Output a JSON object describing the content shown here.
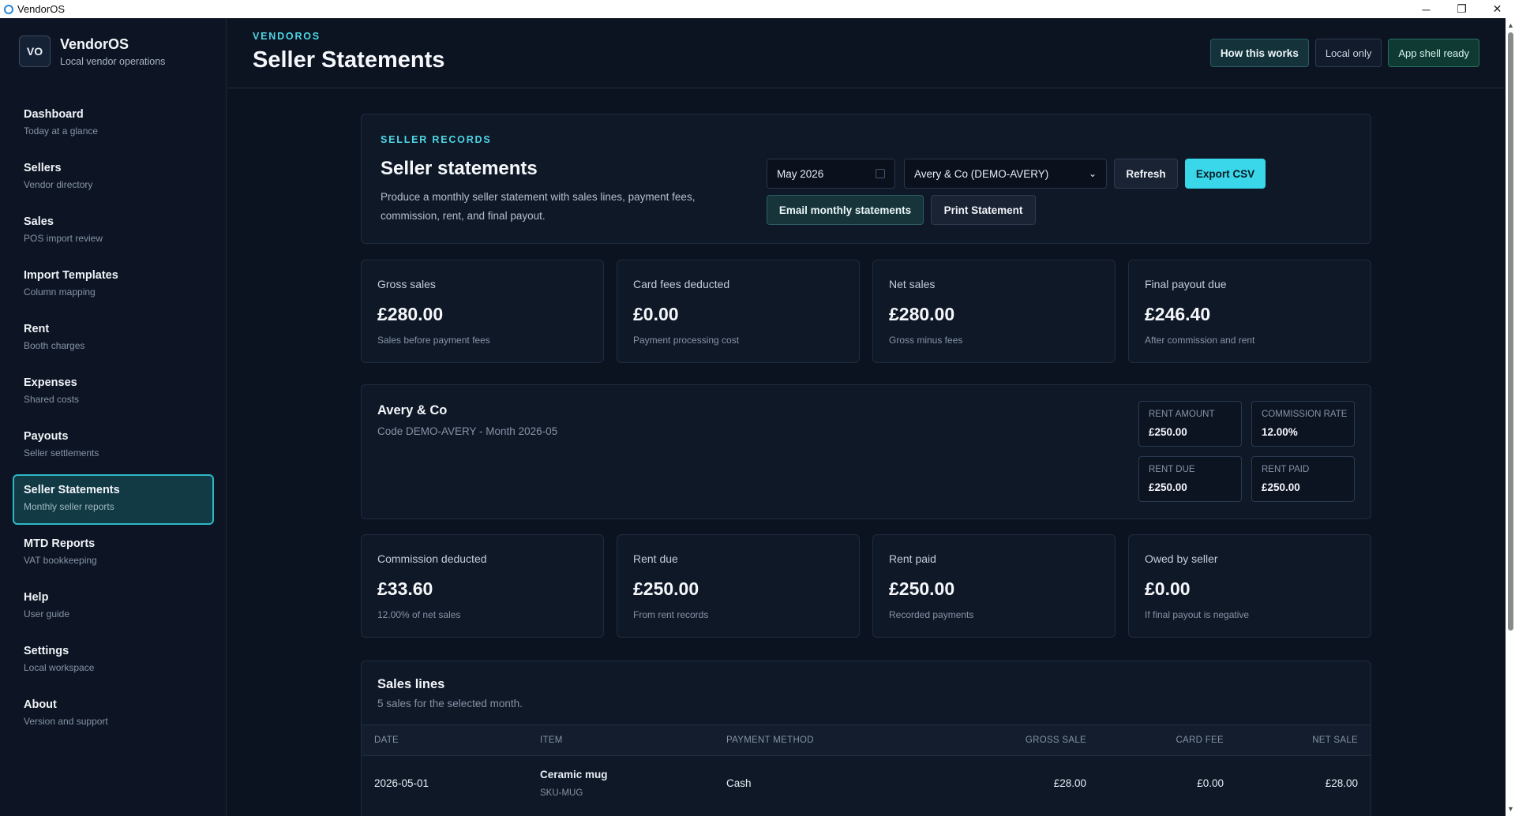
{
  "window": {
    "title": "VendorOS",
    "controls": {
      "minimize": "─",
      "restore": "❐",
      "close": "✕"
    }
  },
  "sidebar": {
    "logo_initials": "VO",
    "brand_name": "VendorOS",
    "brand_sub": "Local vendor operations",
    "items": [
      {
        "label": "Dashboard",
        "sub": "Today at a glance"
      },
      {
        "label": "Sellers",
        "sub": "Vendor directory"
      },
      {
        "label": "Sales",
        "sub": "POS import review"
      },
      {
        "label": "Import Templates",
        "sub": "Column mapping"
      },
      {
        "label": "Rent",
        "sub": "Booth charges"
      },
      {
        "label": "Expenses",
        "sub": "Shared costs"
      },
      {
        "label": "Payouts",
        "sub": "Seller settlements"
      },
      {
        "label": "Seller Statements",
        "sub": "Monthly seller reports",
        "active": true
      },
      {
        "label": "MTD Reports",
        "sub": "VAT bookkeeping"
      },
      {
        "label": "Help",
        "sub": "User guide"
      },
      {
        "label": "Settings",
        "sub": "Local workspace"
      },
      {
        "label": "About",
        "sub": "Version and support"
      }
    ]
  },
  "header": {
    "eyebrow": "VENDOROS",
    "title": "Seller Statements",
    "how_button": "How this works",
    "local_badge": "Local only",
    "ready_badge": "App shell ready"
  },
  "records": {
    "eyebrow": "SELLER RECORDS",
    "title": "Seller statements",
    "description": "Produce a monthly seller statement with sales lines, payment fees, commission, rent, and final payout.",
    "month_value": "May 2026",
    "seller_value": "Avery & Co (DEMO-AVERY)",
    "refresh": "Refresh",
    "export": "Export CSV",
    "email": "Email monthly statements",
    "print": "Print Statement"
  },
  "stats_top": [
    {
      "label": "Gross sales",
      "value": "£280.00",
      "sub": "Sales before payment fees"
    },
    {
      "label": "Card fees deducted",
      "value": "£0.00",
      "sub": "Payment processing cost"
    },
    {
      "label": "Net sales",
      "value": "£280.00",
      "sub": "Gross minus fees"
    },
    {
      "label": "Final payout due",
      "value": "£246.40",
      "sub": "After commission and rent"
    }
  ],
  "seller": {
    "name": "Avery & Co",
    "code_line": "Code DEMO-AVERY - Month 2026-05",
    "rent_amount_label": "RENT AMOUNT",
    "rent_amount": "£250.00",
    "commission_rate_label": "COMMISSION RATE",
    "commission_rate": "12.00%",
    "rent_due_label": "RENT DUE",
    "rent_due": "£250.00",
    "rent_paid_label": "RENT PAID",
    "rent_paid": "£250.00"
  },
  "stats_bottom": [
    {
      "label": "Commission deducted",
      "value": "£33.60",
      "sub": "12.00% of net sales"
    },
    {
      "label": "Rent due",
      "value": "£250.00",
      "sub": "From rent records"
    },
    {
      "label": "Rent paid",
      "value": "£250.00",
      "sub": "Recorded payments"
    },
    {
      "label": "Owed by seller",
      "value": "£0.00",
      "sub": "If final payout is negative"
    }
  ],
  "sales": {
    "title": "Sales lines",
    "subtitle": "5 sales for the selected month.",
    "columns": [
      "DATE",
      "ITEM",
      "PAYMENT METHOD",
      "GROSS SALE",
      "CARD FEE",
      "NET SALE"
    ],
    "rows": [
      {
        "date": "2026-05-01",
        "item": "Ceramic mug",
        "sku": "SKU-MUG",
        "method": "Cash",
        "gross": "£28.00",
        "fee": "£0.00",
        "net": "£28.00"
      }
    ]
  }
}
